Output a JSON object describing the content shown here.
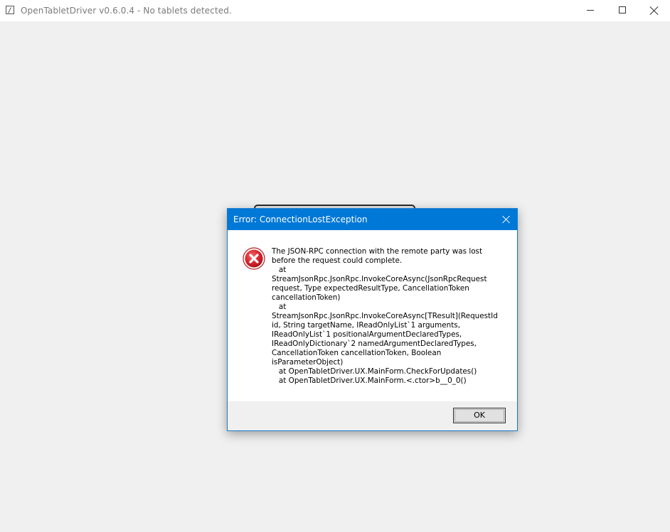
{
  "window": {
    "title": "OpenTabletDriver v0.6.0.4 - No tablets detected.",
    "icon": "app-icon",
    "controls": [
      "minimize-icon",
      "maximize-icon",
      "close-icon"
    ]
  },
  "dialog": {
    "title": "Error: ConnectionLostException",
    "icon": "error-icon",
    "icon_color": "#e81123",
    "title_bar_color": "#0078d7",
    "message": "The JSON-RPC connection with the remote party was lost\nbefore the request could complete.\n   at\nStreamJsonRpc.JsonRpc.InvokeCoreAsync(JsonRpcRequest\nrequest, Type expectedResultType, CancellationToken\ncancellationToken)\n   at\nStreamJsonRpc.JsonRpc.InvokeCoreAsync[TResult](RequestId\nid, String targetName, IReadOnlyList`1 arguments,\nIReadOnlyList`1 positionalArgumentDeclaredTypes,\nIReadOnlyDictionary`2 namedArgumentDeclaredTypes,\nCancellationToken cancellationToken, Boolean\nisParameterObject)\n   at OpenTabletDriver.UX.MainForm.CheckForUpdates()\n   at OpenTabletDriver.UX.MainForm.<.ctor>b__0_0()",
    "ok_label": "OK"
  }
}
